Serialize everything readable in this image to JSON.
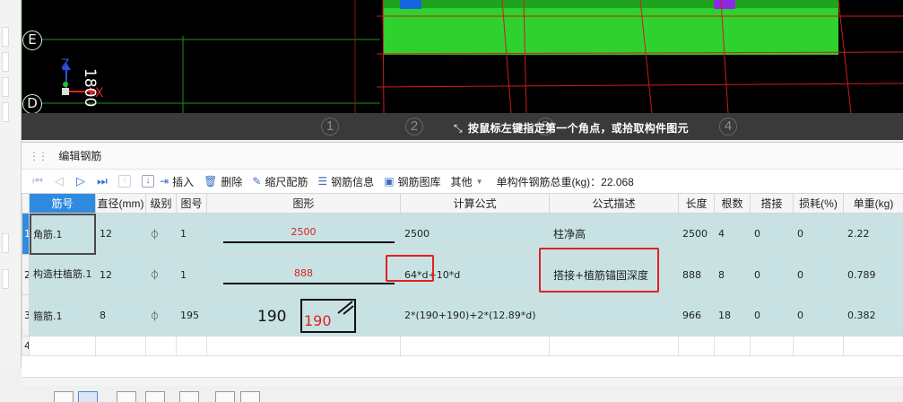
{
  "canvas": {
    "axis_labels": [
      "E",
      "D"
    ],
    "dimension_text": "1800",
    "coord_labels": {
      "z": "Z",
      "x": "X"
    },
    "grid_numbers": [
      "1",
      "2",
      "3",
      "4"
    ],
    "status_tip": "按鼠标左键指定第一个角点，或拾取构件图元"
  },
  "panel": {
    "title": "编辑钢筋",
    "toolbar": {
      "insert": "插入",
      "delete": "删除",
      "scale_rebar": "缩尺配筋",
      "rebar_info": "钢筋信息",
      "rebar_library": "钢筋图库",
      "other": "其他",
      "total_weight": "单构件钢筋总重(kg)：22.068"
    }
  },
  "table": {
    "headers": [
      "筋号",
      "直径(mm)",
      "级别",
      "图号",
      "图形",
      "计算公式",
      "公式描述",
      "长度",
      "根数",
      "搭接",
      "损耗(%)",
      "单重(kg)"
    ],
    "rows": [
      {
        "num": "1",
        "name": "角筋.1",
        "diameter": "12",
        "level": "⏀",
        "fig": "1",
        "shape_value": "2500",
        "formula": "2500",
        "desc": "柱净高",
        "length": "2500",
        "count": "4",
        "lap": "0",
        "loss": "0",
        "weight": "2.22"
      },
      {
        "num": "2",
        "name": "构造柱植筋.1",
        "diameter": "12",
        "level": "⏀",
        "fig": "1",
        "shape_value": "888",
        "formula": "64*d+10*d",
        "desc": "搭接+植筋锚固深度",
        "length": "888",
        "count": "8",
        "lap": "0",
        "loss": "0",
        "weight": "0.789"
      },
      {
        "num": "3",
        "name": "箍筋.1",
        "diameter": "8",
        "level": "⏀",
        "fig": "195",
        "shape_label": "190",
        "shape_value": "190",
        "formula": "2*(190+190)+2*(12.89*d)",
        "desc": "",
        "length": "966",
        "count": "18",
        "lap": "0",
        "loss": "0",
        "weight": "0.382"
      },
      {
        "num": "4"
      }
    ]
  },
  "colors": {
    "highlight": "#2f8be0",
    "row_bg": "#c8e2e4",
    "annotation": "#e02020",
    "slab": "#2ed12e"
  }
}
